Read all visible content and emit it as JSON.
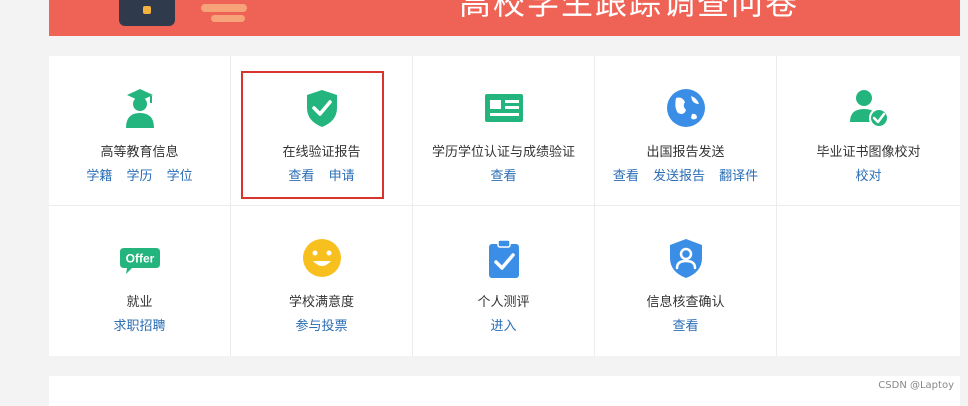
{
  "banner": {
    "title": "高校学生跟踪调查问卷"
  },
  "services": [
    {
      "title": "高等教育信息",
      "links": [
        "学籍",
        "学历",
        "学位"
      ],
      "icon": "graduate-icon"
    },
    {
      "title": "在线验证报告",
      "links": [
        "查看",
        "申请"
      ],
      "icon": "shield-check-icon"
    },
    {
      "title": "学历学位认证与成绩验证",
      "links": [
        "查看"
      ],
      "icon": "id-card-icon"
    },
    {
      "title": "出国报告发送",
      "links": [
        "查看",
        "发送报告",
        "翻译件"
      ],
      "icon": "globe-icon"
    },
    {
      "title": "毕业证书图像校对",
      "links": [
        "校对"
      ],
      "icon": "user-check-icon"
    },
    {
      "title": "就业",
      "links": [
        "求职招聘"
      ],
      "icon": "offer-icon",
      "badge": "Offer"
    },
    {
      "title": "学校满意度",
      "links": [
        "参与投票"
      ],
      "icon": "smiley-icon"
    },
    {
      "title": "个人测评",
      "links": [
        "进入"
      ],
      "icon": "clipboard-check-icon"
    },
    {
      "title": "信息核查确认",
      "links": [
        "查看"
      ],
      "icon": "shield-user-icon"
    }
  ],
  "watermark": "CSDN @Laptoy",
  "colors": {
    "banner": "#ef6356",
    "icon_green": "#24b47e",
    "icon_blue": "#3a8ee6",
    "icon_yellow": "#f7c01e",
    "link": "#2a6db4",
    "highlight": "#d9332e"
  }
}
